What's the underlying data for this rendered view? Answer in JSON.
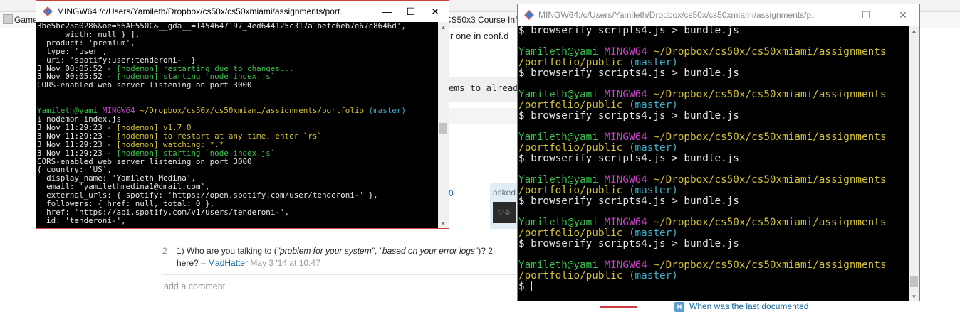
{
  "background_page": {
    "topbar_text": "",
    "bookmark_game": "Game",
    "bookmark_course": "CS50x3 Course Info",
    "snippet_conf": "r one in conf.d",
    "snippet_seems": "ems to already",
    "vote_zero": "0",
    "asked_label": "asked",
    "avatar_text": "♡☺",
    "comment_vote": "2",
    "comment_prefix": "1) Who are you talking to (",
    "comment_quote1": "\"problem for your system\"",
    "comment_mid": ", ",
    "comment_quote2": "\"based on your error logs\"",
    "comment_suffix": ")? 2",
    "comment_line2_prefix": "here? – ",
    "comment_author": "MadHatter",
    "comment_date": " May 3 '14 at 10:47",
    "add_comment": "add a comment",
    "related_badge": "H",
    "related_link": "When was the last documented"
  },
  "left_terminal": {
    "title": "MINGW64:/c/Users/Yamileth/Dropbox/cs50x/cs50xmiami/assignments/port...",
    "minimize_label": "—",
    "maximize_label": "☐",
    "close_label": "✕",
    "lines": [
      {
        "segments": [
          {
            "t": "3be5bc25a0286&oe=56AE550C&__gda__=1454647197_4ed644125c317a1befc6eb7e67c8646d',",
            "c": "white"
          }
        ]
      },
      {
        "segments": [
          {
            "t": "      width: null } ],",
            "c": "white"
          }
        ]
      },
      {
        "segments": [
          {
            "t": "  product: 'premium',",
            "c": "white"
          }
        ]
      },
      {
        "segments": [
          {
            "t": "  type: 'user',",
            "c": "white"
          }
        ]
      },
      {
        "segments": [
          {
            "t": "  uri: 'spotify:user:tenderoni-' }",
            "c": "white"
          }
        ]
      },
      {
        "segments": [
          {
            "t": "3 Nov 00:05:52 - ",
            "c": "white"
          },
          {
            "t": "[nodemon] restarting due to changes...",
            "c": "green"
          }
        ]
      },
      {
        "segments": [
          {
            "t": "3 Nov 00:05:52 - ",
            "c": "white"
          },
          {
            "t": "[nodemon] starting `node index.js`",
            "c": "green"
          }
        ]
      },
      {
        "segments": [
          {
            "t": "CORS-enabled web server listening on port 3000",
            "c": "white"
          }
        ]
      },
      {
        "segments": [
          {
            "t": "",
            "c": "white"
          }
        ]
      },
      {
        "segments": [
          {
            "t": "",
            "c": "white"
          }
        ]
      },
      {
        "segments": [
          {
            "t": "Yamileth@yami ",
            "c": "green"
          },
          {
            "t": "MINGW64 ",
            "c": "magenta"
          },
          {
            "t": "~/Dropbox/cs50x/cs50xmiami/assignments/portfolio ",
            "c": "yellow"
          },
          {
            "t": "(master)",
            "c": "cyan"
          }
        ]
      },
      {
        "segments": [
          {
            "t": "$ nodemon index.js",
            "c": "white"
          }
        ]
      },
      {
        "segments": [
          {
            "t": "3 Nov 11:29:23 - ",
            "c": "white"
          },
          {
            "t": "[nodemon] v1.7.0",
            "c": "yellow"
          }
        ]
      },
      {
        "segments": [
          {
            "t": "3 Nov 11:29:23 - ",
            "c": "white"
          },
          {
            "t": "[nodemon] to restart at any time, enter `rs`",
            "c": "yellow"
          }
        ]
      },
      {
        "segments": [
          {
            "t": "3 Nov 11:29:23 - ",
            "c": "white"
          },
          {
            "t": "[nodemon] watching: *.*",
            "c": "yellow"
          }
        ]
      },
      {
        "segments": [
          {
            "t": "3 Nov 11:29:23 - ",
            "c": "white"
          },
          {
            "t": "[nodemon] starting `node index.js`",
            "c": "green"
          }
        ]
      },
      {
        "segments": [
          {
            "t": "CORS-enabled web server listening on port 3000",
            "c": "white"
          }
        ]
      },
      {
        "segments": [
          {
            "t": "{ country: 'US',",
            "c": "white"
          }
        ]
      },
      {
        "segments": [
          {
            "t": "  display_name: 'Yamileth Medina',",
            "c": "white"
          }
        ]
      },
      {
        "segments": [
          {
            "t": "  email: 'yamilethmedina1@gmail.com',",
            "c": "white"
          }
        ]
      },
      {
        "segments": [
          {
            "t": "  external_urls: { spotify: 'https://open.spotify.com/user/tenderoni-' },",
            "c": "white"
          }
        ]
      },
      {
        "segments": [
          {
            "t": "  followers: { href: null, total: 0 },",
            "c": "white"
          }
        ]
      },
      {
        "segments": [
          {
            "t": "  href: 'https://api.spotify.com/v1/users/tenderoni-',",
            "c": "white"
          }
        ]
      },
      {
        "segments": [
          {
            "t": "  id: 'tenderoni-',",
            "c": "white"
          }
        ]
      }
    ]
  },
  "right_terminal": {
    "title": "MINGW64:/c/Users/Yamileth/Dropbox/cs50x/cs50xmiami/assignments/p...",
    "minimize_label": "—",
    "maximize_label": "☐",
    "close_label": "✕",
    "lines": [
      {
        "segments": [
          {
            "t": "$ browserify scripts4.js > bundle.js",
            "c": "white"
          }
        ]
      },
      {
        "segments": [
          {
            "t": "",
            "c": "white"
          }
        ]
      },
      {
        "segments": [
          {
            "t": "Yamileth@yami ",
            "c": "green"
          },
          {
            "t": "MINGW64 ",
            "c": "magenta"
          },
          {
            "t": "~/Dropbox/cs50x/cs50xmiami/assignments",
            "c": "yellow"
          }
        ]
      },
      {
        "segments": [
          {
            "t": "/portfolio/public ",
            "c": "yellow"
          },
          {
            "t": "(master)",
            "c": "cyan"
          }
        ]
      },
      {
        "segments": [
          {
            "t": "$ browserify scripts4.js > bundle.js",
            "c": "white"
          }
        ]
      },
      {
        "segments": [
          {
            "t": "",
            "c": "white"
          }
        ]
      },
      {
        "segments": [
          {
            "t": "Yamileth@yami ",
            "c": "green"
          },
          {
            "t": "MINGW64 ",
            "c": "magenta"
          },
          {
            "t": "~/Dropbox/cs50x/cs50xmiami/assignments",
            "c": "yellow"
          }
        ]
      },
      {
        "segments": [
          {
            "t": "/portfolio/public ",
            "c": "yellow"
          },
          {
            "t": "(master)",
            "c": "cyan"
          }
        ]
      },
      {
        "segments": [
          {
            "t": "$ browserify scripts4.js > bundle.js",
            "c": "white"
          }
        ]
      },
      {
        "segments": [
          {
            "t": "",
            "c": "white"
          }
        ]
      },
      {
        "segments": [
          {
            "t": "Yamileth@yami ",
            "c": "green"
          },
          {
            "t": "MINGW64 ",
            "c": "magenta"
          },
          {
            "t": "~/Dropbox/cs50x/cs50xmiami/assignments",
            "c": "yellow"
          }
        ]
      },
      {
        "segments": [
          {
            "t": "/portfolio/public ",
            "c": "yellow"
          },
          {
            "t": "(master)",
            "c": "cyan"
          }
        ]
      },
      {
        "segments": [
          {
            "t": "$ browserify scripts4.js > bundle.js",
            "c": "white"
          }
        ]
      },
      {
        "segments": [
          {
            "t": "",
            "c": "white"
          }
        ]
      },
      {
        "segments": [
          {
            "t": "Yamileth@yami ",
            "c": "green"
          },
          {
            "t": "MINGW64 ",
            "c": "magenta"
          },
          {
            "t": "~/Dropbox/cs50x/cs50xmiami/assignments",
            "c": "yellow"
          }
        ]
      },
      {
        "segments": [
          {
            "t": "/portfolio/public ",
            "c": "yellow"
          },
          {
            "t": "(master)",
            "c": "cyan"
          }
        ]
      },
      {
        "segments": [
          {
            "t": "$ browserify scripts4.js > bundle.js",
            "c": "white"
          }
        ]
      },
      {
        "segments": [
          {
            "t": "",
            "c": "white"
          }
        ]
      },
      {
        "segments": [
          {
            "t": "Yamileth@yami ",
            "c": "green"
          },
          {
            "t": "MINGW64 ",
            "c": "magenta"
          },
          {
            "t": "~/Dropbox/cs50x/cs50xmiami/assignments",
            "c": "yellow"
          }
        ]
      },
      {
        "segments": [
          {
            "t": "/portfolio/public ",
            "c": "yellow"
          },
          {
            "t": "(master)",
            "c": "cyan"
          }
        ]
      },
      {
        "segments": [
          {
            "t": "$ browserify scripts4.js > bundle.js",
            "c": "white"
          }
        ]
      },
      {
        "segments": [
          {
            "t": "",
            "c": "white"
          }
        ]
      },
      {
        "segments": [
          {
            "t": "Yamileth@yami ",
            "c": "green"
          },
          {
            "t": "MINGW64 ",
            "c": "magenta"
          },
          {
            "t": "~/Dropbox/cs50x/cs50xmiami/assignments",
            "c": "yellow"
          }
        ]
      },
      {
        "segments": [
          {
            "t": "/portfolio/public ",
            "c": "yellow"
          },
          {
            "t": "(master)",
            "c": "cyan"
          }
        ]
      },
      {
        "segments": [
          {
            "t": "$ ",
            "c": "white"
          }
        ],
        "cursor": true
      }
    ]
  },
  "colors": {
    "green": "#3cbf4f",
    "magenta": "#c646c6",
    "yellow": "#d3c238",
    "cyan": "#3bb1c9",
    "white": "#d4d4d4",
    "active_border": "#c9463d",
    "link": "#0c65a5"
  },
  "icons": {
    "window_icon": "git-bash-diamond-icon"
  }
}
